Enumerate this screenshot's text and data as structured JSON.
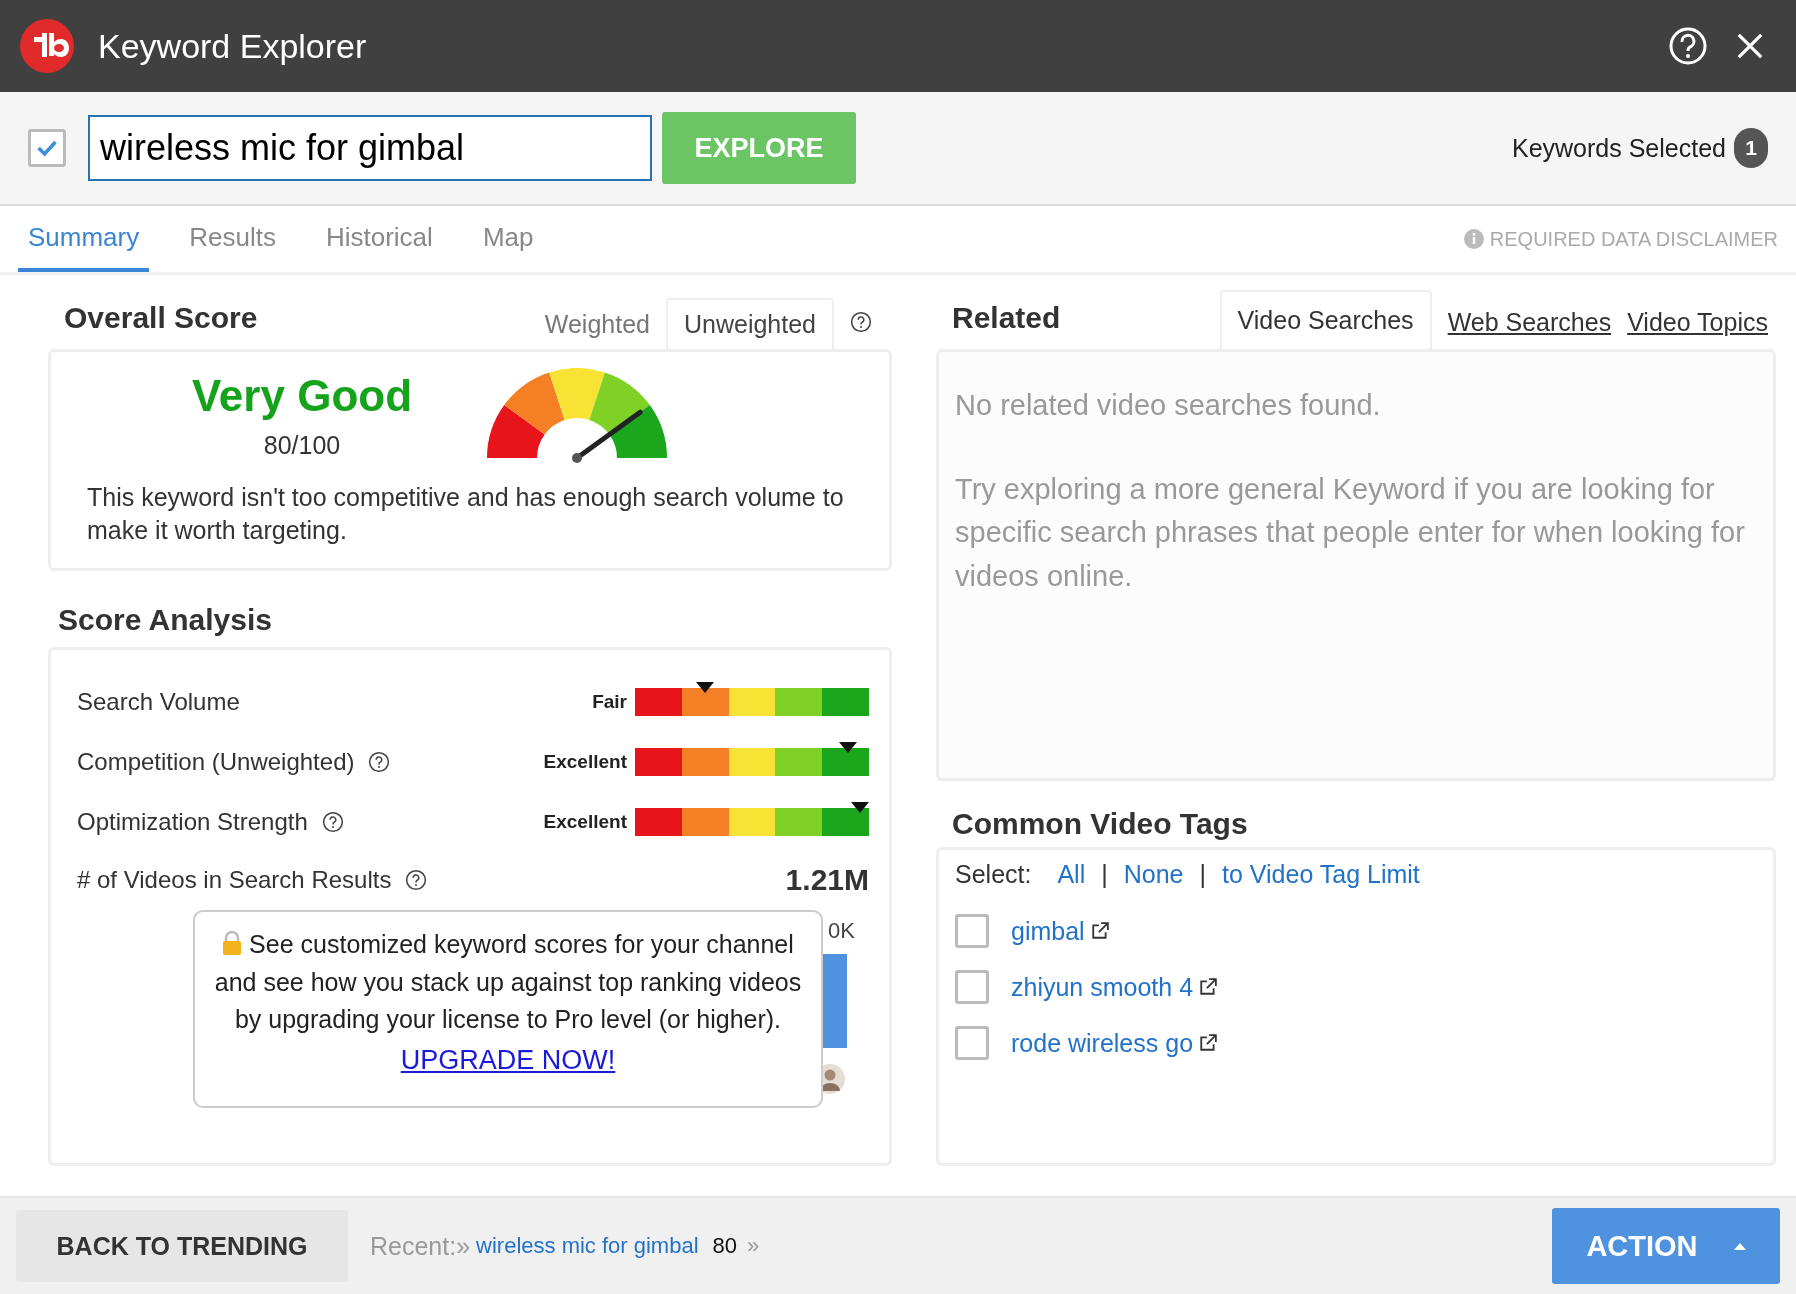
{
  "window": {
    "title": "Keyword Explorer"
  },
  "search": {
    "checked": true,
    "value": "wireless mic for gimbal",
    "button": "EXPLORE"
  },
  "keywords_selected": {
    "label": "Keywords Selected",
    "count": "1"
  },
  "tabs": [
    {
      "label": "Summary",
      "selected": true
    },
    {
      "label": "Results",
      "selected": false
    },
    {
      "label": "Historical",
      "selected": false
    },
    {
      "label": "Map",
      "selected": false
    }
  ],
  "disclaimer": "REQUIRED DATA DISCLAIMER",
  "overall_score": {
    "title": "Overall Score",
    "modes": [
      {
        "label": "Weighted",
        "selected": false
      },
      {
        "label": "Unweighted",
        "selected": true
      }
    ],
    "rating": "Very Good",
    "score": "80/100",
    "level": 0.8,
    "description": "This keyword isn't too competitive and has enough search volume to make it worth targeting."
  },
  "score_analysis": {
    "title": "Score Analysis",
    "metrics": [
      {
        "name": "Search Volume",
        "help": false,
        "rating": "Fair",
        "level": 0.3
      },
      {
        "name": "Competition (Unweighted)",
        "help": true,
        "rating": "Excellent",
        "level": 0.91
      },
      {
        "name": "Optimization Strength",
        "help": true,
        "rating": "Excellent",
        "level": 0.96
      }
    ],
    "videos": {
      "name": "# of Videos in Search Results",
      "value": "1.21M"
    },
    "chart_label": "0K",
    "upgrade": {
      "text": "See customized keyword scores for your channel and see how you stack up against top ranking videos by upgrading your license to Pro level (or higher).",
      "link": "UPGRADE NOW!"
    }
  },
  "related": {
    "title": "Related",
    "tabs": [
      {
        "label": "Video Searches",
        "selected": true
      },
      {
        "label": "Web Searches",
        "selected": false
      },
      {
        "label": "Video Topics",
        "selected": false
      }
    ],
    "empty": "No related video searches found.",
    "hint": "Try exploring a more general Keyword if you are looking for specific search phrases that people enter for when looking for videos online."
  },
  "tags": {
    "title": "Common Video Tags",
    "select_label": "Select:",
    "select_options": [
      "All",
      "None",
      "to Video Tag Limit"
    ],
    "separator": "|",
    "items": [
      {
        "label": "gimbal",
        "checked": false
      },
      {
        "label": "zhiyun smooth 4",
        "checked": false
      },
      {
        "label": "rode wireless go",
        "checked": false
      }
    ]
  },
  "footer": {
    "back": "BACK TO TRENDING",
    "recent_label": "Recent:»",
    "recent_keyword": "wireless mic for gimbal",
    "recent_score": "80",
    "more": "»",
    "action": "ACTION"
  }
}
